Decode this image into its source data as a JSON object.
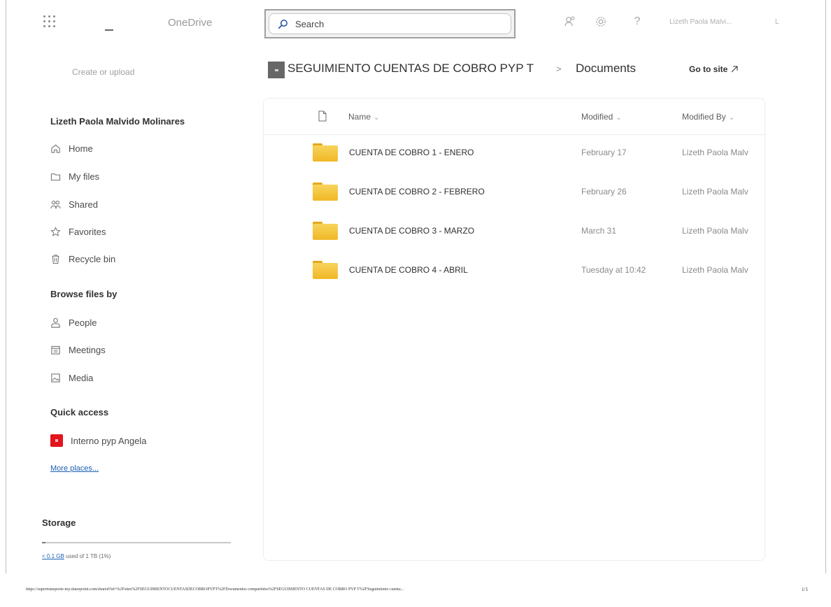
{
  "topbar": {
    "app_name": "OneDrive",
    "search_placeholder": "Search",
    "user_name": "Lizeth Paola Malvi...",
    "user_initial": "L"
  },
  "nav": {
    "create_label": "Create or upload",
    "user_header": "Lizeth Paola Malvido Molinares",
    "items": [
      {
        "label": "Home",
        "icon": "home-icon"
      },
      {
        "label": "My files",
        "icon": "folder-icon"
      },
      {
        "label": "Shared",
        "icon": "people-icon"
      },
      {
        "label": "Favorites",
        "icon": "star-icon"
      },
      {
        "label": "Recycle bin",
        "icon": "trash-icon"
      }
    ],
    "browse_header": "Browse files by",
    "browse_items": [
      {
        "label": "People",
        "icon": "person-icon"
      },
      {
        "label": "Meetings",
        "icon": "calendar-icon"
      },
      {
        "label": "Media",
        "icon": "image-icon"
      }
    ],
    "quick_access_header": "Quick access",
    "quick_access_items": [
      {
        "label": "Interno pyp Angela",
        "color": "#e3141c"
      }
    ],
    "more_places": "More places..."
  },
  "storage": {
    "title": "Storage",
    "used_link": "< 0.1 GB",
    "used_rest": " used of 1 TB (1%)",
    "fraction_used": 0.01
  },
  "breadcrumb": {
    "site": "SEGUIMIENTO CUENTAS DE COBRO PYP T",
    "separator": ">",
    "current": "Documents",
    "go_to_site": "Go to site"
  },
  "table": {
    "columns": [
      "Name",
      "Modified",
      "Modified By"
    ],
    "rows": [
      {
        "name": "CUENTA DE COBRO 1 - ENERO",
        "modified": "February 17",
        "modified_by": "Lizeth Paola Malv"
      },
      {
        "name": "CUENTA DE COBRO 2 - FEBRERO",
        "modified": "February 26",
        "modified_by": "Lizeth Paola Malv"
      },
      {
        "name": "CUENTA DE COBRO 3 - MARZO",
        "modified": "March 31",
        "modified_by": "Lizeth Paola Malv"
      },
      {
        "name": "CUENTA DE COBRO 4 - ABRIL",
        "modified": "Tuesday at 10:42",
        "modified_by": "Lizeth Paola Malv"
      }
    ]
  },
  "footer": {
    "url": "https://supertransporte-my.sharepoint.com/shared?id=%2Fsites%2FSEGUIMIENTOCUENTASDECOBROPYPT%2FDocumentos compartidos%2FSEGUIMIENTO CUENTAS DE COBRO PYP T%2FSeguimiento cuenta...",
    "page": "1/1"
  },
  "colors": {
    "folder": "#f0b826",
    "link": "#1a5fb4",
    "quick_access_badge": "#e3141c"
  }
}
